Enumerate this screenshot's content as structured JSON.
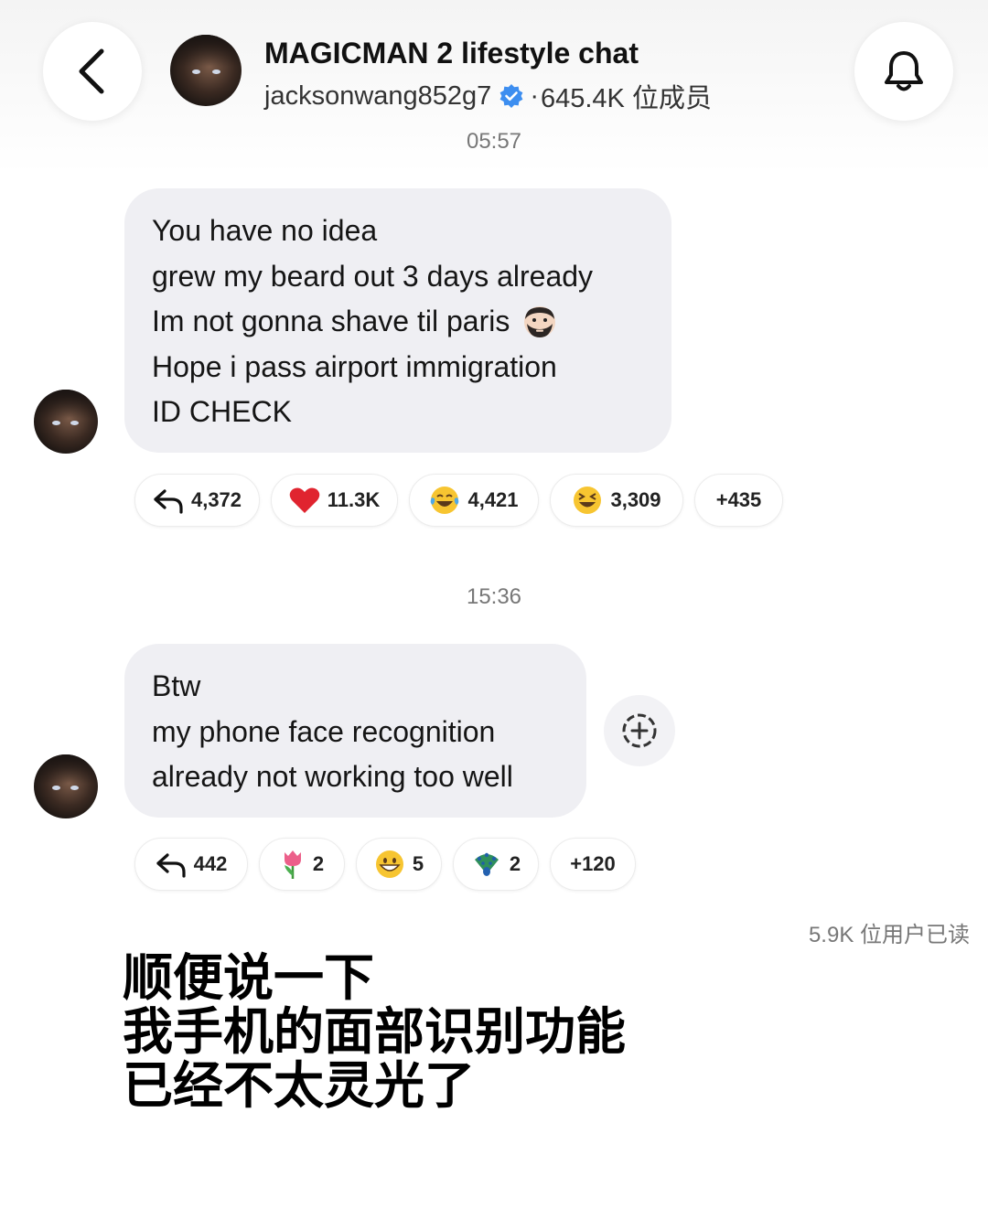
{
  "header": {
    "title": "MAGICMAN 2 lifestyle chat",
    "username": "jacksonwang852g7",
    "separator": "·",
    "member_count": "645.4K 位成员",
    "back_icon": "chevron-left-icon",
    "bell_icon": "bell-icon",
    "verified_icon": "verified-badge-icon",
    "verified_color": "#3d8ef0"
  },
  "messages": [
    {
      "time": "05:57",
      "lines": [
        "You have no idea",
        "grew my beard out 3 days already",
        "Im not gonna shave til paris",
        "Hope i pass airport immigration",
        "ID CHECK"
      ],
      "inline_emoji": "bearded-man-emoji",
      "reactions": [
        {
          "icon": "reply-icon",
          "count": "4,372"
        },
        {
          "icon": "red-heart-emoji",
          "count": "11.3K"
        },
        {
          "icon": "tears-of-joy-emoji",
          "count": "4,421"
        },
        {
          "icon": "squinting-laugh-emoji",
          "count": "3,309"
        },
        {
          "icon": "",
          "count": "+435"
        }
      ]
    },
    {
      "time": "15:36",
      "lines": [
        "Btw",
        "my phone face recognition",
        "already not working too well"
      ],
      "reactions": [
        {
          "icon": "reply-icon",
          "count": "442"
        },
        {
          "icon": "tulip-emoji",
          "count": "2"
        },
        {
          "icon": "grinning-face-emoji",
          "count": "5"
        },
        {
          "icon": "peacock-emoji",
          "count": "2"
        },
        {
          "icon": "",
          "count": "+120"
        }
      ]
    }
  ],
  "read_receipt": "5.9K 位用户已读",
  "caption": {
    "line1": "顺便说一下",
    "line2": "我手机的面部识别功能",
    "line3": "已经不太灵光了"
  },
  "colors": {
    "bubble": "#efeff3",
    "heart": "#e0242f",
    "emoji_yellow": "#f7c531"
  }
}
